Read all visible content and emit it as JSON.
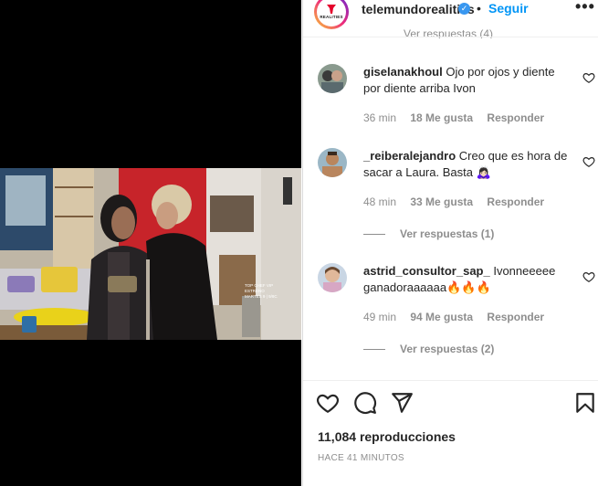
{
  "post": {
    "account": "telemundorealities",
    "brand_label": "REALITIES",
    "follow_label": "Seguir",
    "more_icon": "more-horizontal-icon",
    "views": "11,084 reproducciones",
    "posted": "HACE 41 MINUTOS",
    "accent_color": "#0095f6"
  },
  "video": {
    "overlay_lines": [
      "TOP CHEF VIP",
      "ESTRENO",
      "MARTES 9 | 9/8C"
    ]
  },
  "comments": [
    {
      "user": "giselanakhoul",
      "text": "Ojo por ojos y diente por diente arriba Ivon",
      "time": "36 min",
      "likes": "18 Me gusta",
      "reply": "Responder"
    },
    {
      "user": "_reiberalejandro",
      "text": "Creo que es hora de sacar a Laura. Basta 🙇🏻‍♀️",
      "time": "48 min",
      "likes": "33 Me gusta",
      "reply": "Responder",
      "view_replies": "Ver respuestas (1)"
    },
    {
      "user": "astrid_consultor_sap_",
      "text": "Ivonneeeee ganadoraaaaaa🔥🔥🔥",
      "time": "49 min",
      "likes": "94 Me gusta",
      "reply": "Responder",
      "view_replies": "Ver respuestas (2)"
    }
  ],
  "clipped_reply": "Ver respuestas (4)"
}
